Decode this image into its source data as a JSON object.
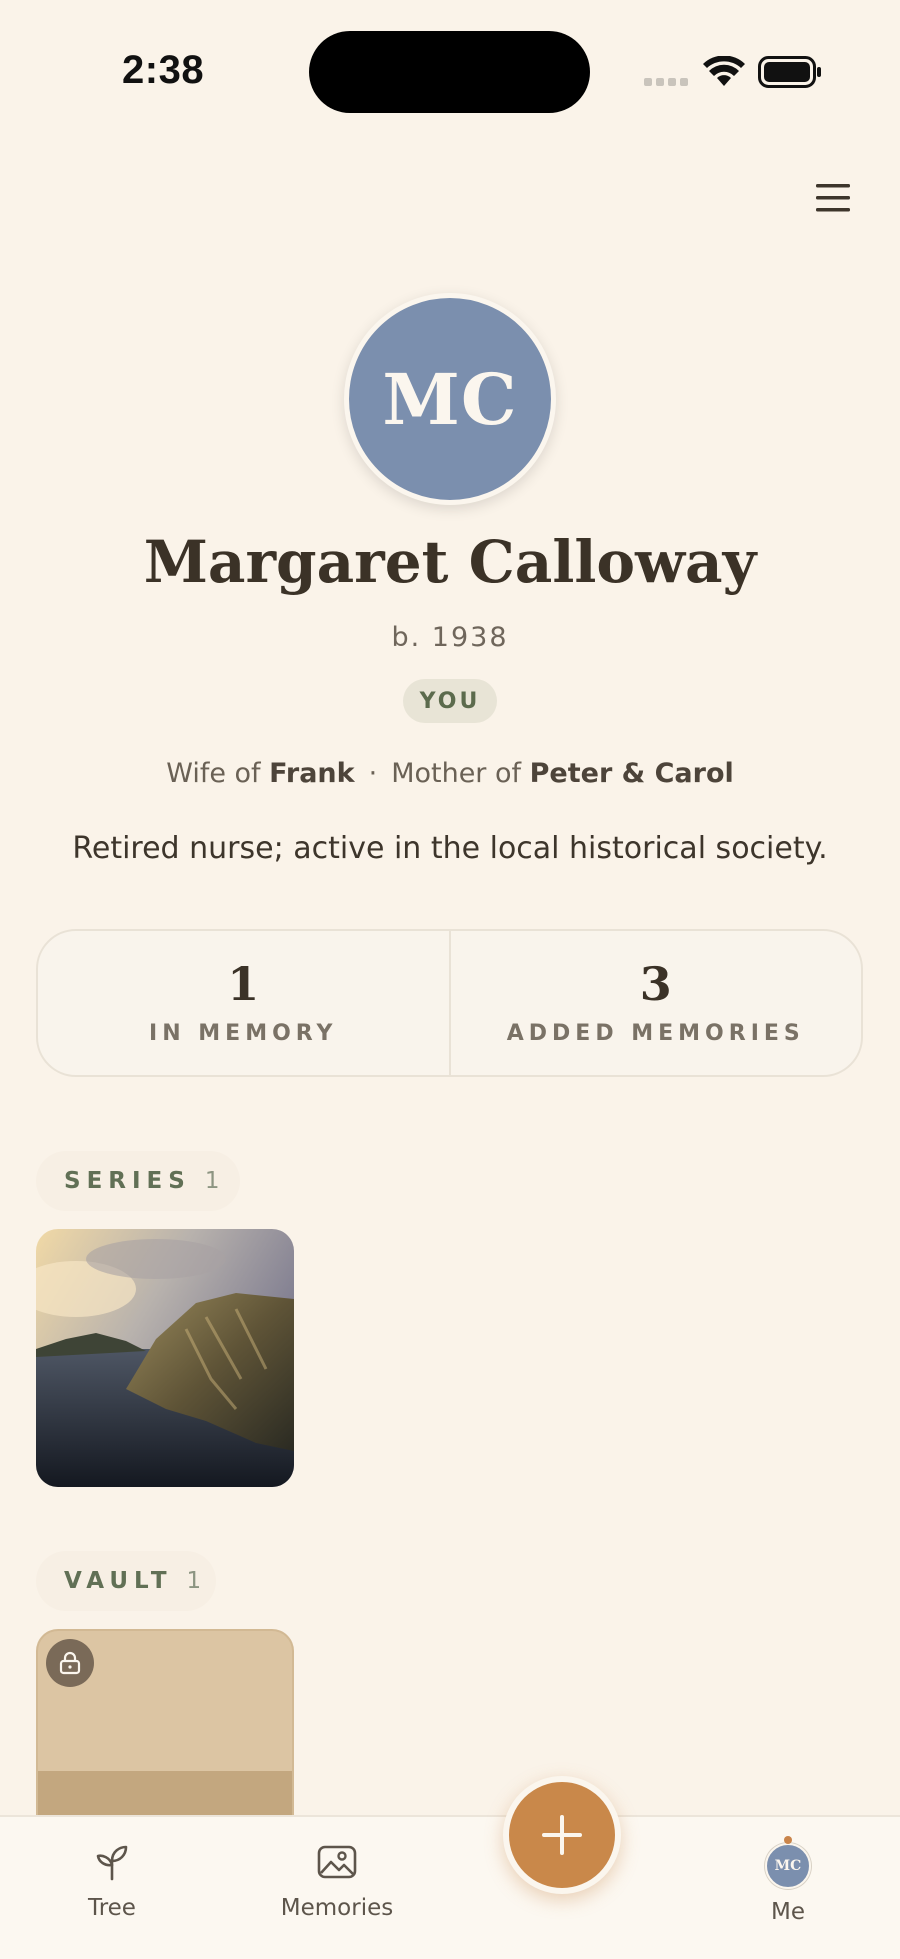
{
  "status_bar": {
    "time": "2:38",
    "icons": [
      "cellular-signal-icon",
      "wifi-icon",
      "battery-icon"
    ]
  },
  "header": {
    "menu_icon": "hamburger-menu-icon"
  },
  "profile": {
    "initials": "MC",
    "avatar_color": "#7b8fae",
    "name": "Margaret Calloway",
    "born": "b. 1938",
    "badge": "YOU",
    "relation_1_prefix": "Wife of",
    "relation_1_name": "Frank",
    "relation_separator": "·",
    "relation_2_prefix": "Mother of",
    "relation_2_name": "Peter & Carol",
    "bio": "Retired nurse; active in the local historical society."
  },
  "stats": [
    {
      "value": "1",
      "label": "IN MEMORY"
    },
    {
      "value": "3",
      "label": "ADDED MEMORIES"
    }
  ],
  "sections": {
    "series": {
      "label": "SERIES",
      "count": "1"
    },
    "vault": {
      "label": "VAULT",
      "count": "1",
      "lock_icon": "lock-icon"
    }
  },
  "tabbar": {
    "tabs": [
      {
        "label": "Tree",
        "icon": "sprout-icon"
      },
      {
        "label": "Memories",
        "icon": "image-icon"
      },
      {
        "label": "Me",
        "icon": "avatar"
      }
    ],
    "me_initials": "MC",
    "add_icon": "plus-icon",
    "accent_color": "#c9884a"
  }
}
